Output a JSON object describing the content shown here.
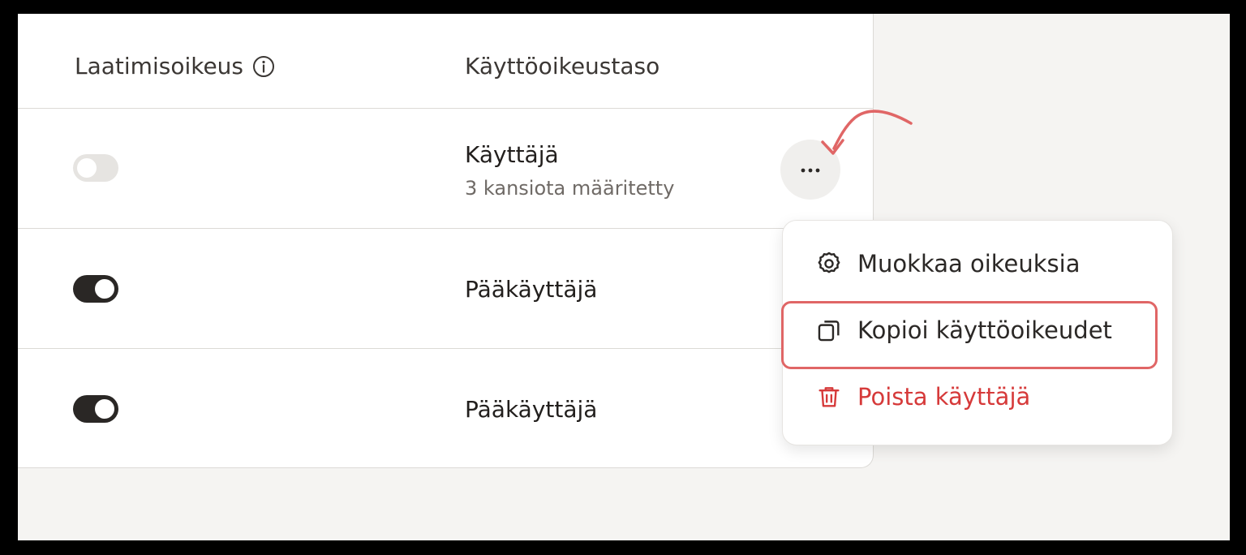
{
  "table": {
    "columns": [
      "Laatimisoikeus",
      "Käyttöoikeustaso"
    ],
    "rows": [
      {
        "toggle_on": false,
        "role": "Käyttäjä",
        "subtitle": "3 kansiota määritetty"
      },
      {
        "toggle_on": true,
        "role": "Pääkäyttäjä"
      },
      {
        "toggle_on": true,
        "role": "Pääkäyttäjä"
      }
    ]
  },
  "row_actions": {
    "icon": "more-horizontal-icon",
    "menu": {
      "items": [
        {
          "label": "Muokkaa oikeuksia",
          "icon": "gear-icon"
        },
        {
          "label": "Kopioi käyttöoikeudet",
          "icon": "copy-icon",
          "highlighted": true
        },
        {
          "label": "Poista käyttäjä",
          "icon": "trash-icon",
          "color": "#d63a3a"
        }
      ]
    }
  },
  "colors": {
    "toggle_on": "#2a2725",
    "toggle_off": "#e6e4e1",
    "danger": "#d63a3a",
    "annotation": "#e06666"
  }
}
